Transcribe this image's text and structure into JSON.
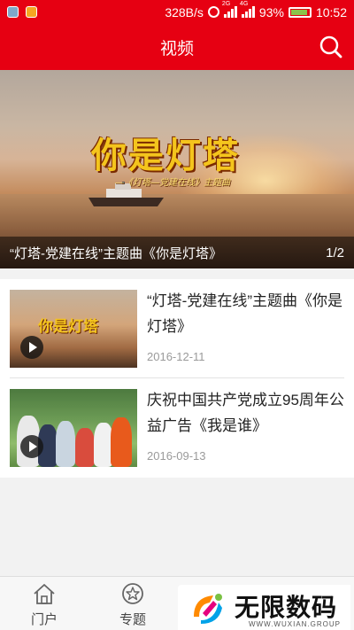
{
  "status_bar": {
    "speed": "328B/s",
    "network_a": "2G",
    "network_b": "4G",
    "battery": "93%",
    "time": "10:52"
  },
  "header": {
    "title": "视频",
    "search_icon": "search-icon"
  },
  "banner": {
    "image_title": "你是灯塔",
    "image_subtitle": "—《灯塔—党建在线》主题曲",
    "caption": "“灯塔-党建在线”主题曲《你是灯塔》",
    "pager": "1/2"
  },
  "videos": [
    {
      "title": "“灯塔-党建在线”主题曲《你是灯塔》",
      "thumb_text": "你是灯塔",
      "date": "2016-12-11"
    },
    {
      "title": "庆祝中国共产党成立95周年公益广告《我是谁》",
      "date": "2016-09-13"
    }
  ],
  "tabs": [
    {
      "label": "门户",
      "icon": "home-icon"
    },
    {
      "label": "专题",
      "icon": "star-icon"
    }
  ],
  "watermark": {
    "title": "无限数码",
    "subtitle": "WWW.WUXIAN.GROUP"
  },
  "colors": {
    "brand_red": "#e60012",
    "banner_title_gold": "#f4c51d"
  }
}
